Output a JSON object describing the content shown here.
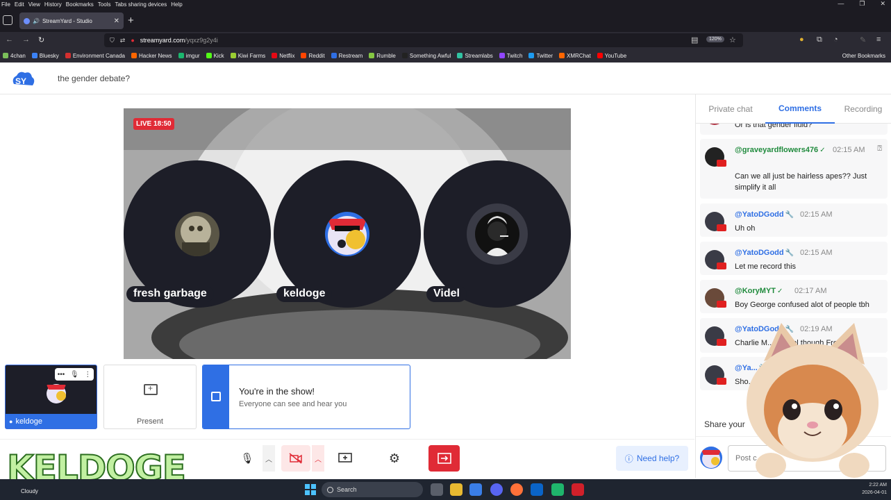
{
  "browser": {
    "menu": [
      "File",
      "Edit",
      "View",
      "History",
      "Bookmarks",
      "Tools",
      "Tabs sharing devices",
      "Help"
    ],
    "tab_title": "StreamYard - Studio",
    "url_domain": "streamyard.com",
    "url_path": "/yqxz9g2y4i",
    "zoom": "120%",
    "bookmarks": [
      {
        "label": "4chan",
        "color": "#7bbf5a"
      },
      {
        "label": "Bluesky",
        "color": "#3b82f6"
      },
      {
        "label": "Environment Canada",
        "color": "#d32f2f"
      },
      {
        "label": "Hacker News",
        "color": "#ff6600"
      },
      {
        "label": "imgur",
        "color": "#1bb76e"
      },
      {
        "label": "Kick",
        "color": "#53fc18"
      },
      {
        "label": "Kiwi Farms",
        "color": "#9acd32"
      },
      {
        "label": "Netflix",
        "color": "#e50914"
      },
      {
        "label": "Reddit",
        "color": "#ff4500"
      },
      {
        "label": "Restream",
        "color": "#2f6fe4"
      },
      {
        "label": "Rumble",
        "color": "#85c742"
      },
      {
        "label": "Something Awful",
        "color": "#222222"
      },
      {
        "label": "Streamlabs",
        "color": "#31c3a2"
      },
      {
        "label": "Twitch",
        "color": "#9146ff"
      },
      {
        "label": "Twitter",
        "color": "#1d9bf0"
      },
      {
        "label": "XMRChat",
        "color": "#ff6600"
      },
      {
        "label": "YouTube",
        "color": "#ff0000"
      }
    ],
    "other_bookmarks": "Other Bookmarks"
  },
  "studio": {
    "broadcast_title": "the gender debate?",
    "live_badge": "LIVE 18:50",
    "participants": [
      {
        "name": "fresh garbage"
      },
      {
        "name": "keldoge"
      },
      {
        "name": "Videl"
      }
    ],
    "self_tile_label": "keldoge",
    "present_label": "Present",
    "notice_title": "You're in the show!",
    "notice_sub": "Everyone can see and hear you",
    "help_label": "Need help?"
  },
  "sidebar": {
    "tabs": [
      "Private chat",
      "Comments",
      "Recording"
    ],
    "active_tab": "Comments",
    "comments": [
      {
        "author": "",
        "time": "",
        "text": "Or is that gender fluid?",
        "color": "blue"
      },
      {
        "author": "@graveyardflowers476",
        "time": "02:15 AM",
        "text": "Can we all just be hairless apes?? Just simplify it all",
        "color": "green"
      },
      {
        "author": "@YatoDGodd",
        "time": "02:15 AM",
        "text": "Uh oh",
        "color": "blue"
      },
      {
        "author": "@YatoDGodd",
        "time": "02:15 AM",
        "text": "Let me record this",
        "color": "blue"
      },
      {
        "author": "@KoryMYT",
        "time": "02:17 AM",
        "text": "Boy George confused alot of people tbh",
        "color": "green"
      },
      {
        "author": "@YatoDGodd",
        "time": "02:19 AM",
        "text": "Charlie M... aid ppl though Free fr...",
        "color": "blue"
      },
      {
        "author": "@Ya...",
        "time": "",
        "text": "Sho...",
        "color": "blue"
      }
    ],
    "share_label": "Share your",
    "post_placeholder": "Post c"
  },
  "overlay": {
    "brand_text": "KELDOGE"
  },
  "taskbar": {
    "weather": "Cloudy",
    "search": "Search",
    "time": "2:22 AM",
    "date": "2026-04-01"
  }
}
